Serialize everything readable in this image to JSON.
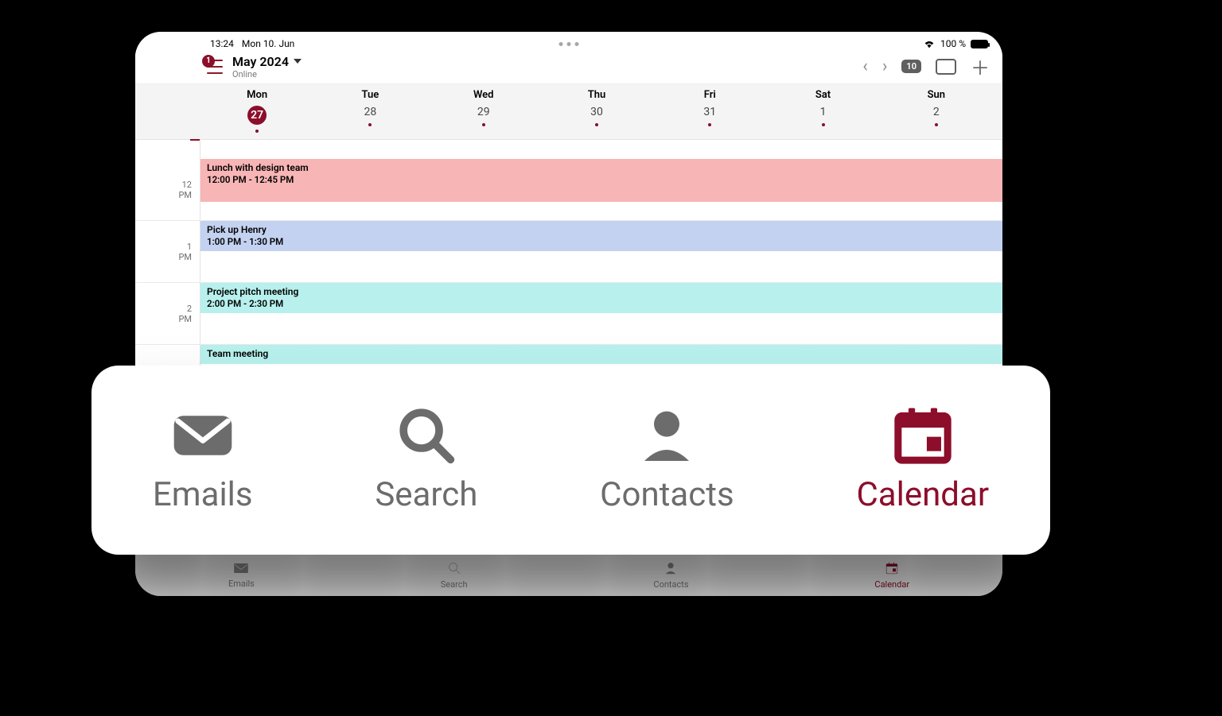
{
  "status": {
    "time": "13:24",
    "date": "Mon 10. Jun",
    "battery_text": "100 %"
  },
  "header": {
    "badge": "1",
    "title": "May 2024",
    "subtitle": "Online",
    "count_badge": "10"
  },
  "days": [
    {
      "name": "Mon",
      "num": "27",
      "today": true
    },
    {
      "name": "Tue",
      "num": "28",
      "today": false
    },
    {
      "name": "Wed",
      "num": "29",
      "today": false
    },
    {
      "name": "Thu",
      "num": "30",
      "today": false
    },
    {
      "name": "Fri",
      "num": "31",
      "today": false
    },
    {
      "name": "Sat",
      "num": "1",
      "today": false
    },
    {
      "name": "Sun",
      "num": "2",
      "today": false
    }
  ],
  "hours": [
    {
      "h": "12",
      "ampm": "PM"
    },
    {
      "h": "1",
      "ampm": "PM"
    },
    {
      "h": "2",
      "ampm": "PM"
    }
  ],
  "events": [
    {
      "title": "Lunch with design team",
      "time": "12:00 PM - 12:45 PM",
      "cls": "ev-pink",
      "row": 0
    },
    {
      "title": "Pick up Henry",
      "time": "1:00 PM - 1:30 PM",
      "cls": "ev-blue",
      "row": 1
    },
    {
      "title": "Project pitch meeting",
      "time": "2:00 PM - 2:30 PM",
      "cls": "ev-cyan",
      "row": 2
    },
    {
      "title": "Team meeting",
      "time": "",
      "cls": "ev-cyan2",
      "row": 3
    }
  ],
  "tabs": [
    {
      "id": "emails",
      "label": "Emails",
      "active": false
    },
    {
      "id": "search",
      "label": "Search",
      "active": false
    },
    {
      "id": "contacts",
      "label": "Contacts",
      "active": false
    },
    {
      "id": "calendar",
      "label": "Calendar",
      "active": true
    }
  ]
}
